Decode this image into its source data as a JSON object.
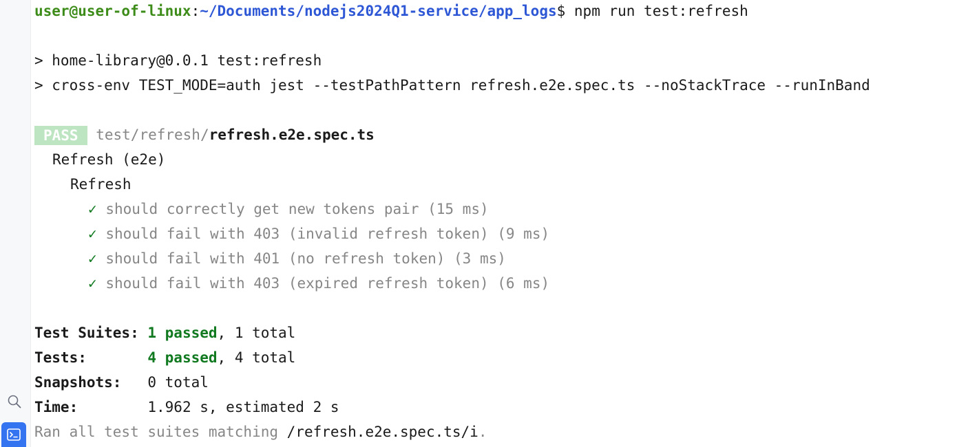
{
  "sidebar": {
    "search_icon": "search-icon",
    "terminal_icon": "terminal-icon",
    "accent": "#3574f0"
  },
  "prompt": {
    "user": "user@user-of-linux",
    "separator": ":",
    "path": "~/Documents/nodejs2024Q1-service/app_logs",
    "dollar": "$ ",
    "command": "npm run test:refresh"
  },
  "script_lines": [
    "> home-library@0.0.1 test:refresh",
    "> cross-env TEST_MODE=auth jest --testPathPattern refresh.e2e.spec.ts --noStackTrace --runInBand"
  ],
  "result": {
    "badge": "PASS",
    "file_dir": "test/refresh/",
    "file_name": "refresh.e2e.spec.ts"
  },
  "suite": {
    "name": "Refresh (e2e)",
    "group": "Refresh",
    "check_mark": "✓",
    "tests": [
      "should correctly get new tokens pair (15 ms)",
      "should fail with 403 (invalid refresh token) (9 ms)",
      "should fail with 401 (no refresh token) (3 ms)",
      "should fail with 403 (expired refresh token) (6 ms)"
    ]
  },
  "summary": {
    "suites_label": "Test Suites: ",
    "suites_passed": "1 passed",
    "suites_total": ", 1 total",
    "tests_label": "Tests:       ",
    "tests_passed": "4 passed",
    "tests_total": ", 4 total",
    "snapshots_label": "Snapshots:   ",
    "snapshots_value": "0 total",
    "time_label": "Time:        ",
    "time_value": "1.962 s, estimated 2 s",
    "ran_prefix": "Ran all test suites matching ",
    "ran_pattern": "/refresh.e2e.spec.ts/i",
    "ran_suffix": "."
  },
  "colors": {
    "prompt_user": "#3d8c1a",
    "prompt_path": "#2e57d6",
    "pass_badge_bg": "#bde5c1",
    "passed_green": "#117a20",
    "dim_text": "#868686"
  }
}
